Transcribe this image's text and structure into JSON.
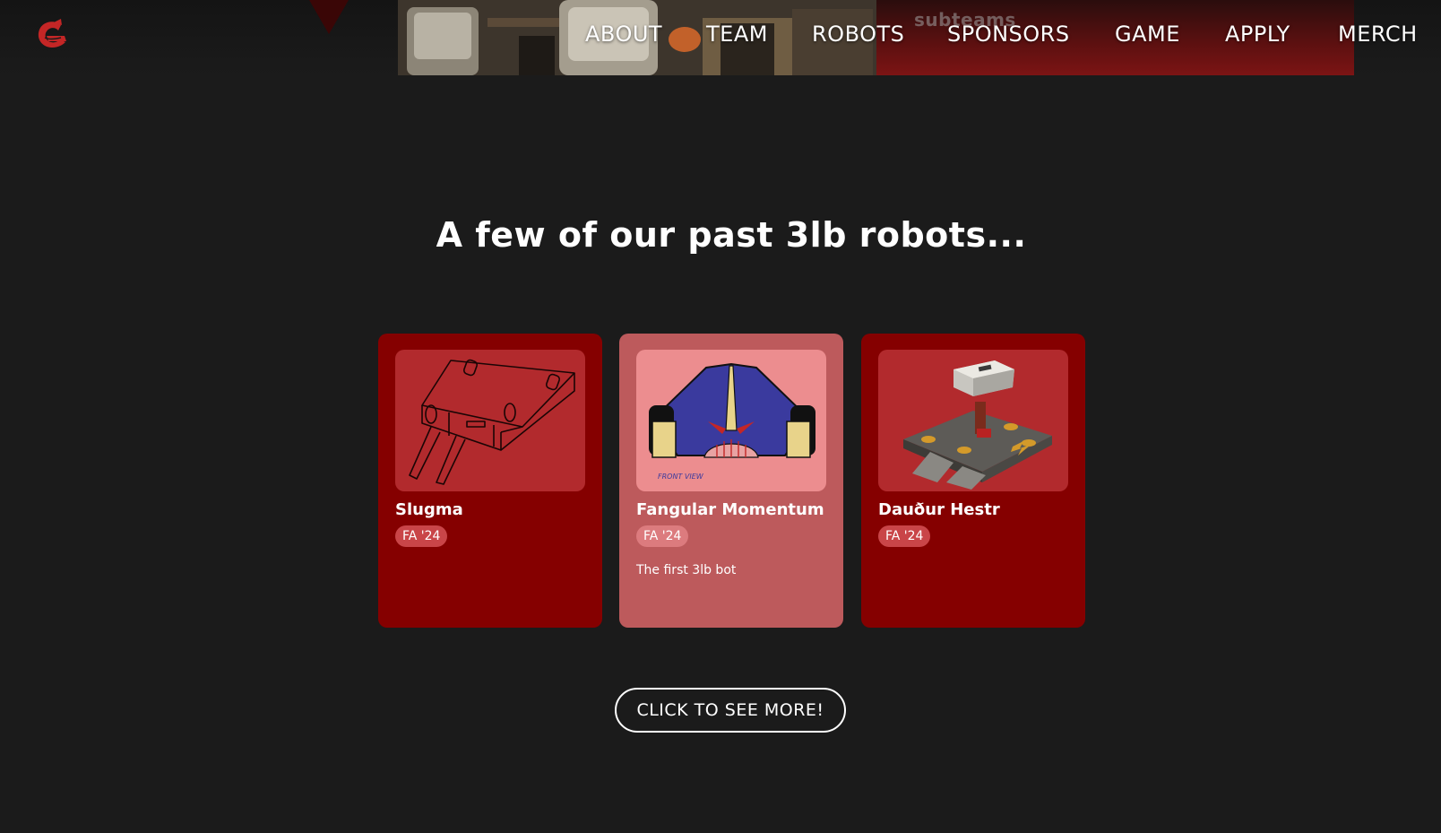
{
  "nav": {
    "items": [
      {
        "label": "ABOUT"
      },
      {
        "label": "TEAM"
      },
      {
        "label": "ROBOTS"
      },
      {
        "label": "SPONSORS"
      },
      {
        "label": "GAME"
      },
      {
        "label": "APPLY"
      },
      {
        "label": "MERCH"
      }
    ]
  },
  "banner": {
    "ghost_text": "subteams"
  },
  "section": {
    "title": "A few of our past 3lb robots...",
    "cards": [
      {
        "name": "Slugma",
        "term": "FA '24",
        "description": "",
        "image_icon": "robot-sketch-icon"
      },
      {
        "name": "Fangular Momentum",
        "term": "FA '24",
        "description": "The first 3lb bot",
        "image_icon": "robot-front-view-drawing-icon",
        "image_caption": "FRONT VIEW"
      },
      {
        "name": "Dauður Hestr",
        "term": "FA '24",
        "description": "",
        "image_icon": "hammer-robot-render-icon"
      }
    ],
    "more_button": "CLICK TO SEE MORE!"
  },
  "colors": {
    "background": "#1b1b1b",
    "card": "#850000",
    "card_highlight": "#bd5a5c",
    "thumb": "#b22a2d",
    "thumb_highlight": "#ec8d8f",
    "accent": "#c42626"
  }
}
